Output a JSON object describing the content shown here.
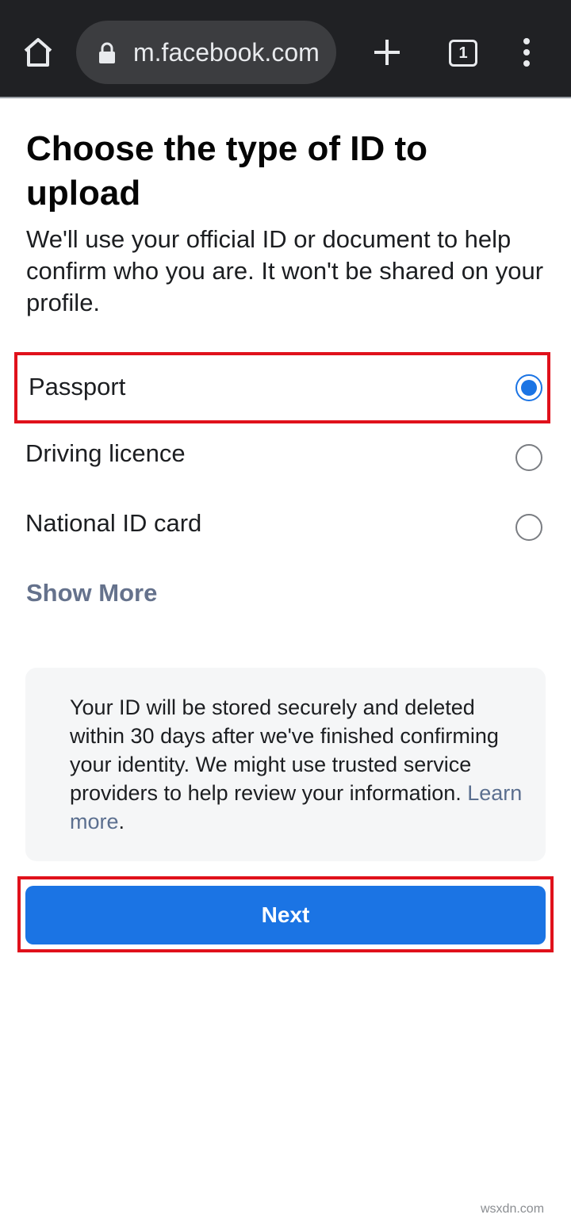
{
  "browser": {
    "url": "m.facebook.com",
    "tab_count": "1"
  },
  "page": {
    "title": "Choose the type of ID to upload",
    "subtitle": "We'll use your official ID or document to help confirm who you are. It won't be shared on your profile."
  },
  "options": [
    {
      "label": "Passport",
      "selected": true
    },
    {
      "label": "Driving licence",
      "selected": false
    },
    {
      "label": "National ID card",
      "selected": false
    }
  ],
  "show_more_label": "Show More",
  "info": {
    "text": "Your ID will be stored securely and deleted within 30 days after we've finished confirming your identity. We might use trusted service providers to help review your information.",
    "learn_more": "Learn more",
    "trailing": "."
  },
  "next_label": "Next",
  "watermark": "wsxdn.com",
  "colors": {
    "accent": "#1b74e4",
    "highlight_border": "#e0111b",
    "link": "#65728c"
  }
}
